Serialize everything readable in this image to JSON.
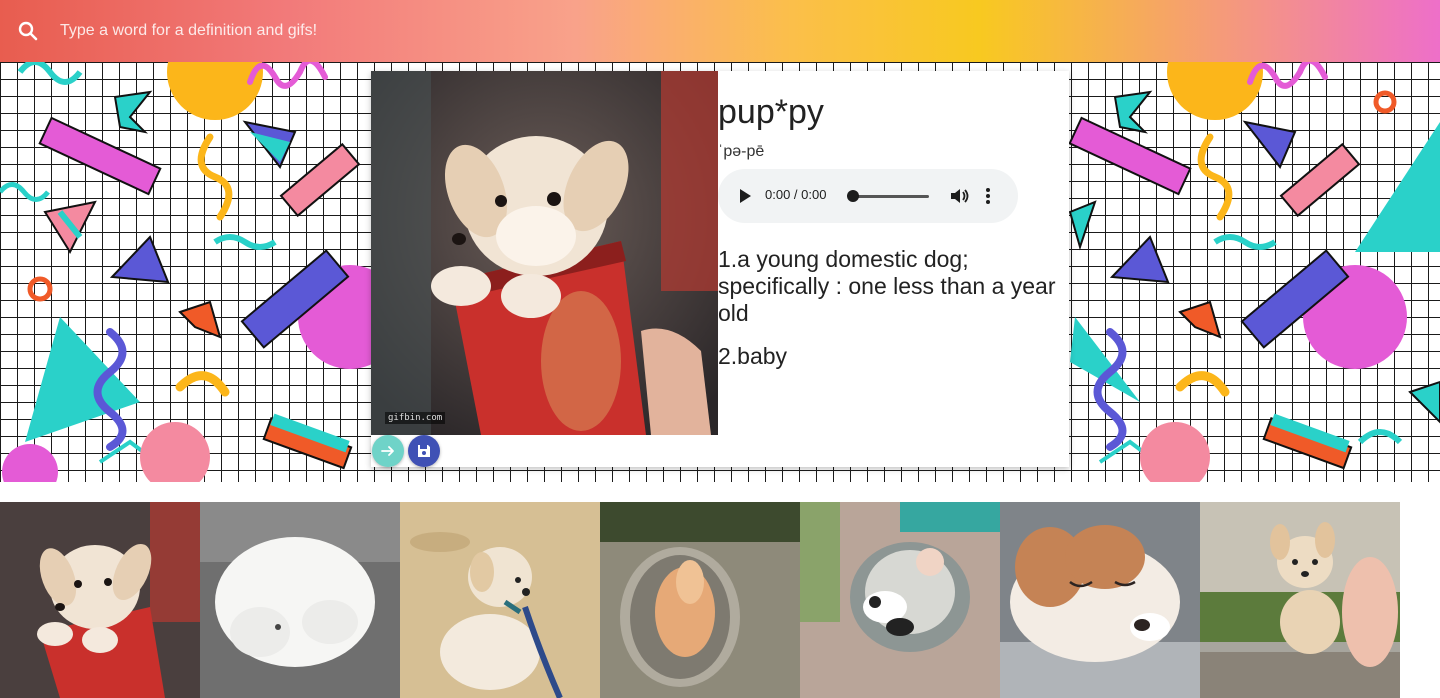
{
  "search": {
    "placeholder": "Type a word for a definition and gifs!",
    "icon": "search-icon"
  },
  "entry": {
    "word": "pup*py",
    "pronunciation": "ˈpə-pē",
    "audio": {
      "time": "0:00 / 0:00",
      "progress": 0
    },
    "definitions": [
      "1.a young domestic dog; specifically : one less than a year old",
      "2.baby"
    ]
  },
  "media": {
    "watermark": "gifbin.com",
    "next_icon": "arrow-right-icon",
    "save_icon": "floppy-disk-icon"
  },
  "gifs": [
    {
      "alt": "puppy in red cup"
    },
    {
      "alt": "fluffy white puppy"
    },
    {
      "alt": "golden puppy on leash"
    },
    {
      "alt": "puppy in metal bowl"
    },
    {
      "alt": "puppy with baby in bouncer"
    },
    {
      "alt": "sleepy puppy"
    },
    {
      "alt": "small puppy held in hand"
    }
  ],
  "colors": {
    "accent_teal": "#6fd3c8",
    "accent_indigo": "#3f51b5"
  }
}
